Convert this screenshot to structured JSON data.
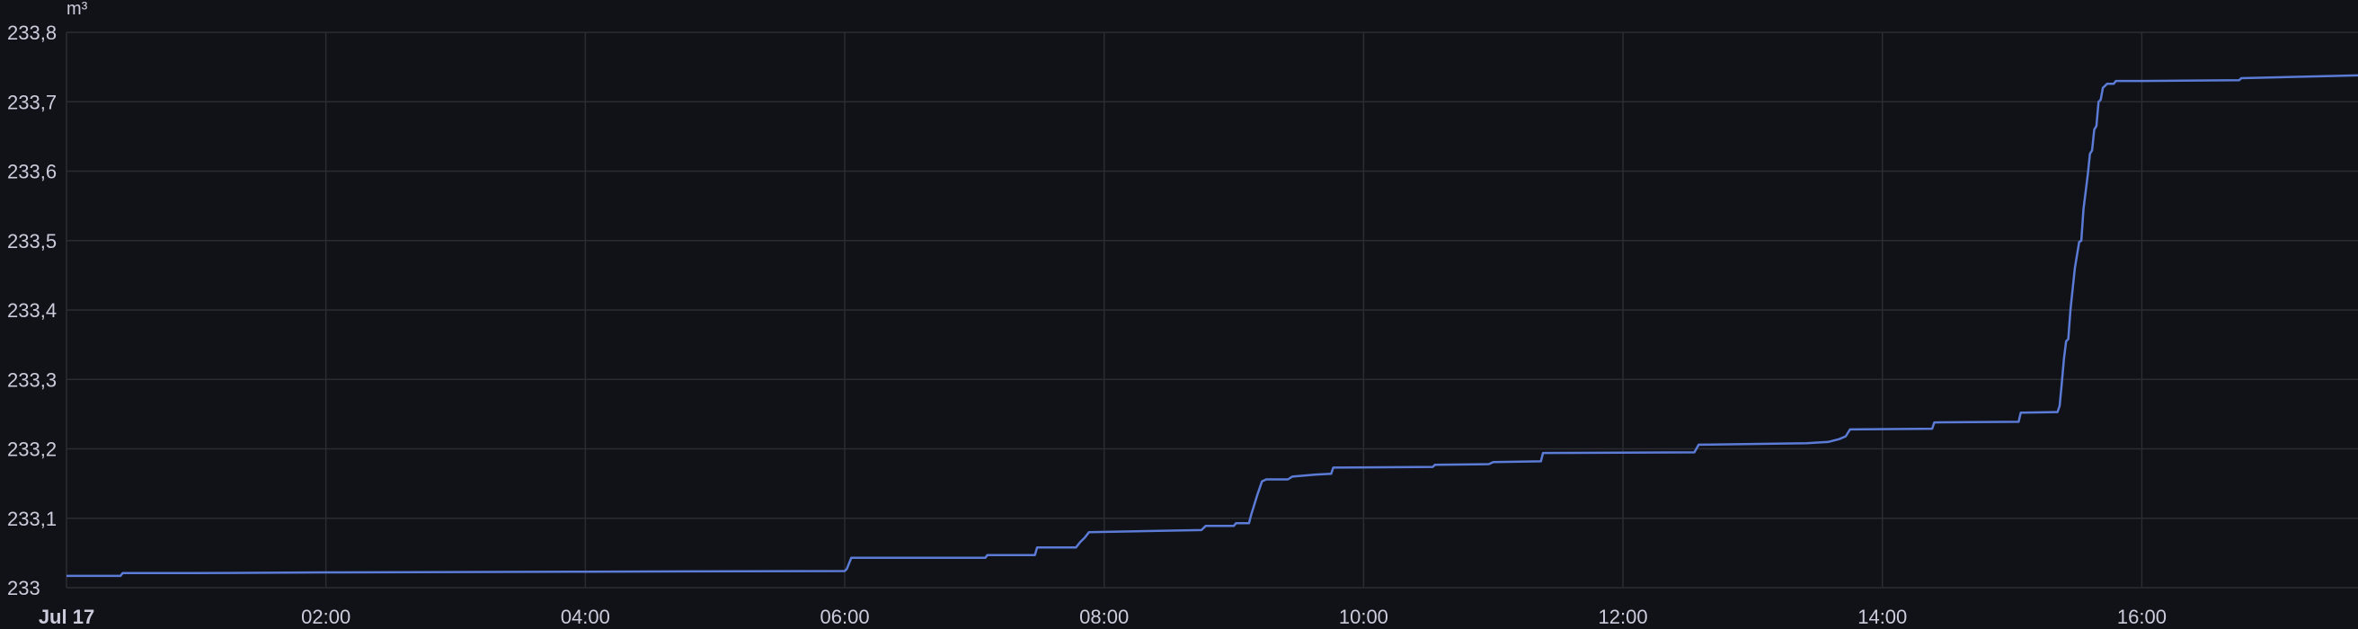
{
  "chart_data": {
    "type": "line",
    "unit": "m³",
    "xlim": [
      "00:00",
      "17:40"
    ],
    "ylim": [
      233.0,
      233.8
    ],
    "grid": true,
    "x_ticks": [
      {
        "t": "00:00",
        "label": "Jul 17"
      },
      {
        "t": "02:00",
        "label": "02:00"
      },
      {
        "t": "04:00",
        "label": "04:00"
      },
      {
        "t": "06:00",
        "label": "06:00"
      },
      {
        "t": "08:00",
        "label": "08:00"
      },
      {
        "t": "10:00",
        "label": "10:00"
      },
      {
        "t": "12:00",
        "label": "12:00"
      },
      {
        "t": "14:00",
        "label": "14:00"
      },
      {
        "t": "16:00",
        "label": "16:00"
      }
    ],
    "y_ticks": [
      {
        "v": 233.0,
        "label": "233"
      },
      {
        "v": 233.1,
        "label": "233,1"
      },
      {
        "v": 233.2,
        "label": "233,2"
      },
      {
        "v": 233.3,
        "label": "233,3"
      },
      {
        "v": 233.4,
        "label": "233,4"
      },
      {
        "v": 233.5,
        "label": "233,5"
      },
      {
        "v": 233.6,
        "label": "233,6"
      },
      {
        "v": 233.7,
        "label": "233,7"
      },
      {
        "v": 233.8,
        "label": "233,8"
      }
    ],
    "series": [
      {
        "color": "#5b7bd6",
        "points": [
          [
            "00:00",
            233.017
          ],
          [
            "00:25",
            233.017
          ],
          [
            "00:26",
            233.021
          ],
          [
            "01:00",
            233.021
          ],
          [
            "02:00",
            233.022
          ],
          [
            "04:00",
            233.023
          ],
          [
            "06:00",
            233.024
          ],
          [
            "06:01",
            233.027
          ],
          [
            "06:02",
            233.035
          ],
          [
            "06:03",
            233.043
          ],
          [
            "07:05",
            233.043
          ],
          [
            "07:06",
            233.047
          ],
          [
            "07:28",
            233.047
          ],
          [
            "07:29",
            233.058
          ],
          [
            "07:47",
            233.058
          ],
          [
            "07:49",
            233.066
          ],
          [
            "07:51",
            233.072
          ],
          [
            "07:53",
            233.08
          ],
          [
            "08:45",
            233.083
          ],
          [
            "08:47",
            233.089
          ],
          [
            "09:00",
            233.089
          ],
          [
            "09:01",
            233.093
          ],
          [
            "09:07",
            233.093
          ],
          [
            "09:08",
            233.105
          ],
          [
            "09:09",
            233.115
          ],
          [
            "09:10",
            233.125
          ],
          [
            "09:11",
            233.135
          ],
          [
            "09:12",
            233.144
          ],
          [
            "09:13",
            233.153
          ],
          [
            "09:15",
            233.156
          ],
          [
            "09:25",
            233.156
          ],
          [
            "09:27",
            233.16
          ],
          [
            "09:38",
            233.163
          ],
          [
            "09:45",
            233.164
          ],
          [
            "09:46",
            233.173
          ],
          [
            "10:32",
            233.174
          ],
          [
            "10:33",
            233.177
          ],
          [
            "10:58",
            233.178
          ],
          [
            "11:00",
            233.181
          ],
          [
            "11:22",
            233.182
          ],
          [
            "11:23",
            233.194
          ],
          [
            "12:33",
            233.195
          ],
          [
            "12:35",
            233.206
          ],
          [
            "13:25",
            233.208
          ],
          [
            "13:35",
            233.21
          ],
          [
            "13:40",
            233.214
          ],
          [
            "13:43",
            233.218
          ],
          [
            "13:45",
            233.228
          ],
          [
            "14:23",
            233.229
          ],
          [
            "14:24",
            233.238
          ],
          [
            "15:03",
            233.239
          ],
          [
            "15:04",
            233.252
          ],
          [
            "15:21",
            233.253
          ],
          [
            "15:22",
            233.262
          ],
          [
            "15:23",
            233.295
          ],
          [
            "15:24",
            233.33
          ],
          [
            "15:25",
            233.355
          ],
          [
            "15:26",
            233.358
          ],
          [
            "15:27",
            233.4
          ],
          [
            "15:29",
            233.46
          ],
          [
            "15:31",
            233.498
          ],
          [
            "15:32",
            233.5
          ],
          [
            "15:33",
            233.545
          ],
          [
            "15:35",
            233.595
          ],
          [
            "15:36",
            233.625
          ],
          [
            "15:37",
            233.63
          ],
          [
            "15:38",
            233.66
          ],
          [
            "15:39",
            233.665
          ],
          [
            "15:40",
            233.7
          ],
          [
            "15:41",
            233.703
          ],
          [
            "15:42",
            233.72
          ],
          [
            "15:44",
            233.726
          ],
          [
            "15:47",
            233.726
          ],
          [
            "15:48",
            233.73
          ],
          [
            "16:00",
            233.73
          ],
          [
            "16:45",
            233.731
          ],
          [
            "16:46",
            233.734
          ],
          [
            "17:40",
            233.738
          ]
        ]
      }
    ]
  }
}
